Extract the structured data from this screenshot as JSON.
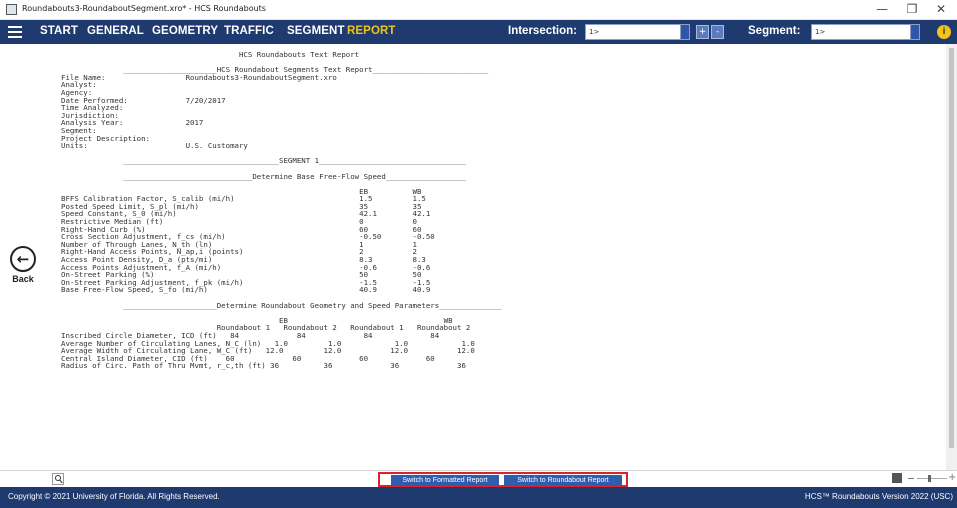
{
  "window": {
    "title": "Roundabouts3-RoundaboutSegment.xro* - HCS Roundabouts",
    "minimize": "—",
    "restore": "❐",
    "close": "✕"
  },
  "menubar": {
    "items": [
      "START",
      "GENERAL",
      "GEOMETRY",
      "TRAFFIC",
      "SEGMENT",
      "REPORT"
    ],
    "active": "REPORT",
    "intersection_label": "Intersection:",
    "intersection_value": "1>",
    "segment_label": "Segment:",
    "segment_value": "1>",
    "prev_glyph": "+",
    "next_glyph": "-",
    "info_glyph": "i"
  },
  "back": {
    "glyph": "←",
    "label": "Back"
  },
  "report": {
    "lines": [
      "                                        HCS Roundabouts Text Report",
      "",
      "              _____________________HCS Roundabout Segments Text Report__________________________",
      "File Name:                  Roundabouts3-RoundaboutSegment.xro",
      "Analyst:",
      "Agency:",
      "Date Performed:             7/20/2017",
      "Time Analyzed:",
      "Jurisdiction:",
      "Analysis Year:              2017",
      "Segment:",
      "Project Description:",
      "Units:                      U.S. Customary",
      "",
      "              ___________________________________SEGMENT 1_________________________________",
      "",
      "              _____________________________Determine Base Free-Flow Speed__________________",
      "",
      "                                                                   EB          WB",
      "BFFS Calibration Factor, S_calib (mi/h)                            1.5         1.5",
      "Posted Speed Limit, S_pl (mi/h)                                    35          35",
      "Speed Constant, S_0 (mi/h)                                         42.1        42.1",
      "Restrictive Median (ft)                                            0           0",
      "Right-Hand Curb (%)                                                60          60",
      "Cross Section Adjustment, f_cs (mi/h)                              -0.50       -0.50",
      "Number of Through Lanes, N_th (ln)                                 1           1",
      "Right-Hand Access Points, N_ap,i (points)                          2           2",
      "Access Point Density, D_a (pts/mi)                                 8.3         8.3",
      "Access Points Adjustment, f_A (mi/h)                               -0.6        -0.6",
      "On-Street Parking (%)                                              50          50",
      "On-Street Parking Adjustment, f_pk (mi/h)                          -1.5        -1.5",
      "Base Free-Flow Speed, S_fo (mi/h)                                  40.9        40.9",
      "",
      "              _____________________Determine Roundabout Geometry and Speed Parameters______________",
      "",
      "                                                 EB                                   WB",
      "                                   Roundabout 1   Roundabout 2   Roundabout 1   Roundabout 2",
      "Inscribed Circle Diameter, ICD (ft)   84             84             84             84",
      "Average Number of Circulating Lanes, N_C (ln)   1.0         1.0            1.0            1.0",
      "Average Width of Circulating Lane, W_C (ft)   12.0         12.0           12.0           12.0",
      "Central Island Diameter, CID (ft)    60             60             60             60",
      "Radius of Circ. Path of Thru Mvmt, r_c,th (ft) 36          36             36             36"
    ]
  },
  "bottom_bar": {
    "btn_formatted": "Switch to Formatted Report",
    "btn_roundabout": "Switch to Roundabout Report"
  },
  "footer": {
    "copyright": "Copyright © 2021 University of Florida. All Rights Reserved.",
    "version": "HCS™ Roundabouts Version 2022 (USC)"
  },
  "colors": {
    "nav_bg": "#1e3a6e",
    "active_menu": "#f3c317",
    "button_blue": "#2f5cae",
    "highlight_red": "#d9242b"
  }
}
